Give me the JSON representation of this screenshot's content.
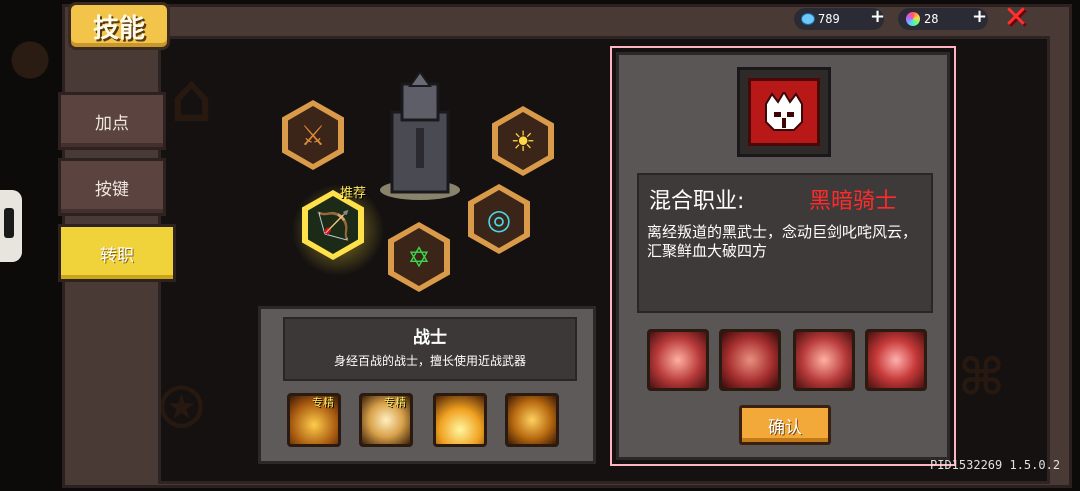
{
  "header": {
    "title": "技能"
  },
  "sidebar": {
    "items": [
      {
        "label": "加点",
        "active": false
      },
      {
        "label": "按键",
        "active": false
      },
      {
        "label": "转职",
        "active": true
      }
    ]
  },
  "currency": {
    "gems": {
      "value": "789",
      "icon": "blue-gem-icon"
    },
    "crystals": {
      "value": "28",
      "icon": "rainbow-crystal-icon"
    },
    "plus_label": "+"
  },
  "close_label": "✕",
  "class_tree": {
    "recommend_label": "推荐",
    "nodes": [
      {
        "icon": "sword-icon",
        "glyph": "⚔"
      },
      {
        "icon": "bow-icon",
        "glyph": "🏹"
      },
      {
        "icon": "hexagram-icon",
        "glyph": "✡"
      },
      {
        "icon": "vortex-icon",
        "glyph": "◎"
      },
      {
        "icon": "sun-icon",
        "glyph": "☀"
      }
    ]
  },
  "current_class": {
    "name": "战士",
    "description": "身经百战的战士，擅长使用近战武器",
    "skills": [
      {
        "icon": "slash-skill-icon",
        "tag": "专精"
      },
      {
        "icon": "spin-skill-icon",
        "tag": "专精"
      },
      {
        "icon": "ground-sword-skill-icon",
        "tag": ""
      },
      {
        "icon": "rage-skill-icon",
        "tag": ""
      }
    ]
  },
  "hybrid": {
    "label": "混合职业:",
    "class_name": "黑暗骑士",
    "description": "离经叛道的黑武士，念动巨剑叱咤风云，汇聚鲜血大破四方",
    "icon": "dark-knight-helmet-icon",
    "skills": [
      {
        "icon": "blood-mace-skill-icon"
      },
      {
        "icon": "blood-orbs-skill-icon"
      },
      {
        "icon": "blood-sword-skill-icon"
      },
      {
        "icon": "blood-burst-skill-icon"
      }
    ],
    "confirm_label": "确认"
  },
  "version": "PID1532269 1.5.0.2",
  "colors": {
    "accent_yellow": "#f0d23a",
    "confirm_orange": "#f2a93a",
    "dark_red": "#b81818",
    "class_name_red": "#ff2a2a"
  }
}
